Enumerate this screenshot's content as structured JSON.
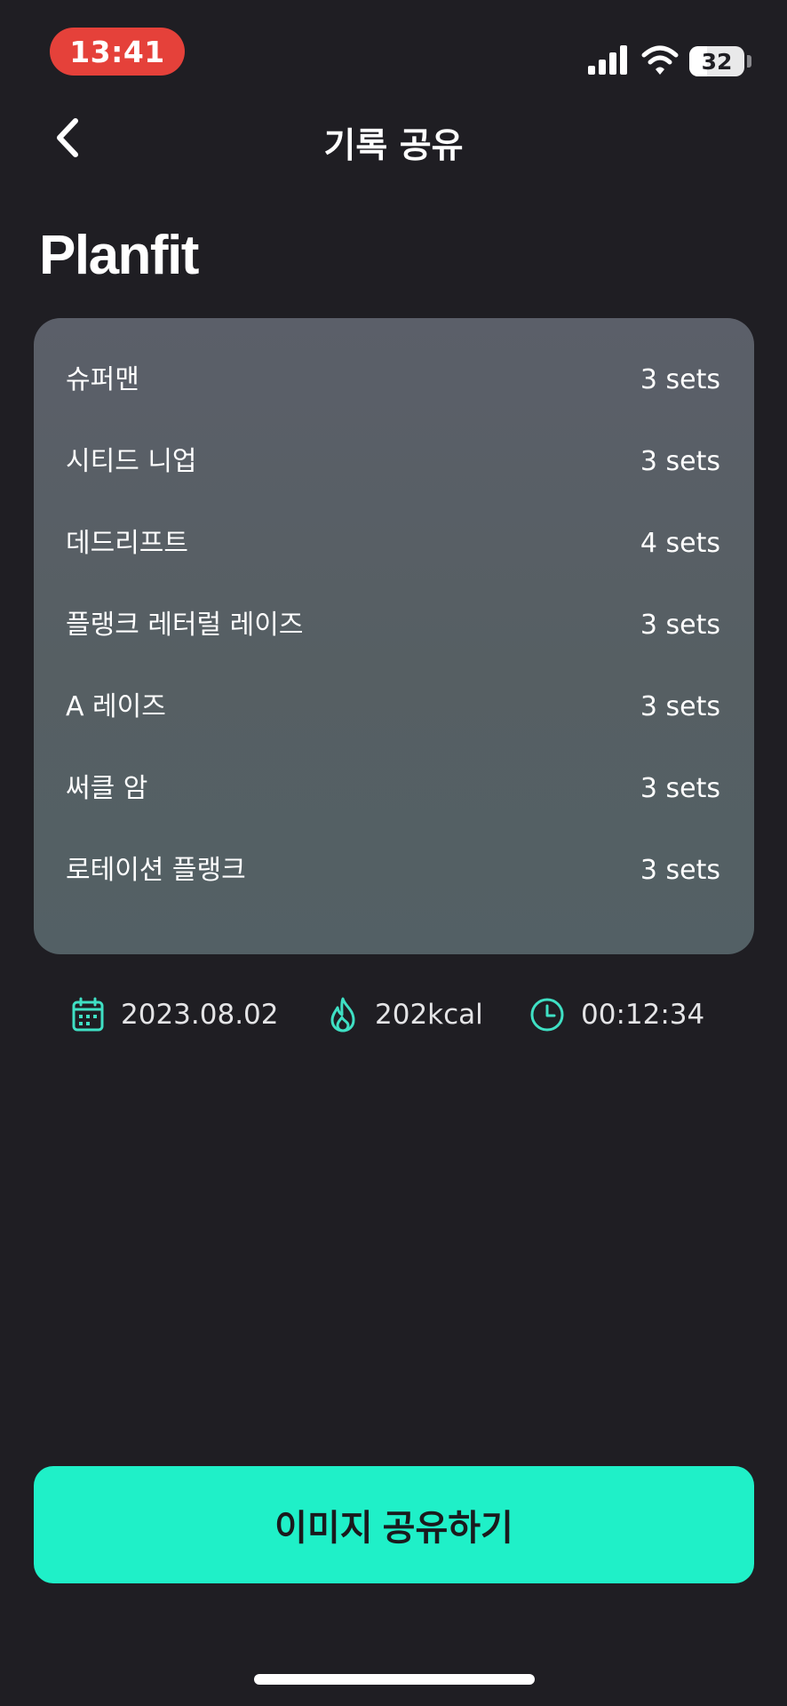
{
  "status_bar": {
    "time": "13:41",
    "battery_level": "32",
    "battery_fraction": 0.32,
    "icons": [
      "signal-icon",
      "wifi-icon",
      "battery-icon"
    ],
    "time_pill_color": "#e5413a"
  },
  "header": {
    "title": "기록 공유",
    "back_icon": "chevron-left-icon"
  },
  "brand": {
    "name": "Planfit"
  },
  "exercises": [
    {
      "name": "슈퍼맨",
      "sets": "3 sets"
    },
    {
      "name": "시티드 니업",
      "sets": "3 sets"
    },
    {
      "name": "데드리프트",
      "sets": "4 sets"
    },
    {
      "name": "플랭크 레터럴 레이즈",
      "sets": "3 sets"
    },
    {
      "name": "A 레이즈",
      "sets": "3 sets"
    },
    {
      "name": "써클 암",
      "sets": "3 sets"
    },
    {
      "name": "로테이션 플랭크",
      "sets": "3 sets"
    }
  ],
  "stats": {
    "date": {
      "icon": "calendar-icon",
      "value": "2023.08.02"
    },
    "calories": {
      "icon": "flame-icon",
      "value": "202kcal"
    },
    "duration": {
      "icon": "clock-icon",
      "value": "00:12:34"
    }
  },
  "share_button": {
    "label": "이미지 공유하기"
  },
  "colors": {
    "background": "#1f1e23",
    "accent": "#1ff0c8",
    "card": "#585f66",
    "stat_icon": "#3fe0c4"
  }
}
